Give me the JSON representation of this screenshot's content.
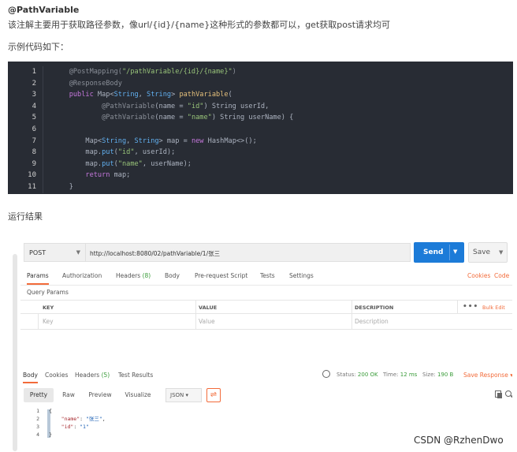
{
  "heading": "@PathVariable",
  "description": "该注解主要用于获取路径参数，像url/{id}/{name}这种形式的参数都可以，get获取post请求均可",
  "sample_label": "示例代码如下：",
  "code": {
    "line_numbers": [
      "1",
      "2",
      "3",
      "4",
      "5",
      "6",
      "7",
      "8",
      "9",
      "10",
      "11"
    ],
    "lines": [
      {
        "segments": [
          {
            "t": "    @PostMapping(",
            "c": "ann"
          },
          {
            "t": "\"/pathVariable/{id}/{name}\"",
            "c": "str"
          },
          {
            "t": ")",
            "c": "ann"
          }
        ]
      },
      {
        "segments": [
          {
            "t": "    @ResponseBody",
            "c": "ann"
          }
        ]
      },
      {
        "segments": [
          {
            "t": "    ",
            "c": ""
          },
          {
            "t": "public",
            "c": "kw"
          },
          {
            "t": " Map<",
            "c": ""
          },
          {
            "t": "String",
            "c": "fn"
          },
          {
            "t": ", ",
            "c": ""
          },
          {
            "t": "String",
            "c": "fn"
          },
          {
            "t": "> ",
            "c": ""
          },
          {
            "t": "pathVariable",
            "c": "ty"
          },
          {
            "t": "(",
            "c": ""
          }
        ]
      },
      {
        "segments": [
          {
            "t": "            @PathVariable",
            "c": "ann"
          },
          {
            "t": "(name = ",
            "c": ""
          },
          {
            "t": "\"id\"",
            "c": "str"
          },
          {
            "t": ") String userId,",
            "c": ""
          }
        ]
      },
      {
        "segments": [
          {
            "t": "            @PathVariable",
            "c": "ann"
          },
          {
            "t": "(name = ",
            "c": ""
          },
          {
            "t": "\"name\"",
            "c": "str"
          },
          {
            "t": ") String userName) {",
            "c": ""
          }
        ]
      },
      {
        "segments": [
          {
            "t": "",
            "c": ""
          }
        ]
      },
      {
        "segments": [
          {
            "t": "        Map<",
            "c": ""
          },
          {
            "t": "String",
            "c": "fn"
          },
          {
            "t": ", ",
            "c": ""
          },
          {
            "t": "String",
            "c": "fn"
          },
          {
            "t": "> map = ",
            "c": ""
          },
          {
            "t": "new",
            "c": "kw"
          },
          {
            "t": " HashMap<>();",
            "c": ""
          }
        ]
      },
      {
        "segments": [
          {
            "t": "        map.",
            "c": ""
          },
          {
            "t": "put",
            "c": "fn"
          },
          {
            "t": "(",
            "c": ""
          },
          {
            "t": "\"id\"",
            "c": "str"
          },
          {
            "t": ", userId);",
            "c": ""
          }
        ]
      },
      {
        "segments": [
          {
            "t": "        map.",
            "c": ""
          },
          {
            "t": "put",
            "c": "fn"
          },
          {
            "t": "(",
            "c": ""
          },
          {
            "t": "\"name\"",
            "c": "str"
          },
          {
            "t": ", userName);",
            "c": ""
          }
        ]
      },
      {
        "segments": [
          {
            "t": "        ",
            "c": ""
          },
          {
            "t": "return",
            "c": "kw"
          },
          {
            "t": " map;",
            "c": ""
          }
        ]
      },
      {
        "segments": [
          {
            "t": "    }",
            "c": ""
          }
        ]
      }
    ]
  },
  "result_label": "运行结果",
  "postman": {
    "method": "POST",
    "url": "http://localhost:8080/02/pathVariable/1/张三",
    "send_label": "Send",
    "save_label": "Save",
    "tabs": {
      "params": "Params",
      "authorization": "Authorization",
      "headers": "Headers",
      "headers_count": "(8)",
      "body": "Body",
      "prerequest": "Pre-request Script",
      "tests": "Tests",
      "settings": "Settings",
      "cookies": "Cookies",
      "code": "Code"
    },
    "query_params_title": "Query Params",
    "columns": {
      "key": "KEY",
      "value": "VALUE",
      "description": "DESCRIPTION",
      "more": "•••",
      "bulk_edit": "Bulk Edit"
    },
    "placeholders": {
      "key": "Key",
      "value": "Value",
      "description": "Description"
    },
    "response_tabs": {
      "body": "Body",
      "cookies": "Cookies",
      "headers": "Headers",
      "headers_count": "(5)",
      "test_results": "Test Results"
    },
    "status": {
      "status_label": "Status:",
      "status_value": "200 OK",
      "time_label": "Time:",
      "time_value": "12 ms",
      "size_label": "Size:",
      "size_value": "190 B",
      "save_response": "Save Response",
      "save_response_chev": "▾"
    },
    "format_buttons": {
      "pretty": "Pretty",
      "raw": "Raw",
      "preview": "Preview",
      "visualize": "Visualize"
    },
    "format_select": "JSON",
    "wrap_icon": "⇌",
    "response_json": {
      "line_numbers": [
        "1",
        "2",
        "3",
        "4"
      ],
      "open": "{",
      "name_key": "\"name\"",
      "name_value": "\"张三\"",
      "id_key": "\"id\"",
      "id_value": "\"1\"",
      "close": "}"
    }
  },
  "watermark": "CSDN @RzhenDwo"
}
